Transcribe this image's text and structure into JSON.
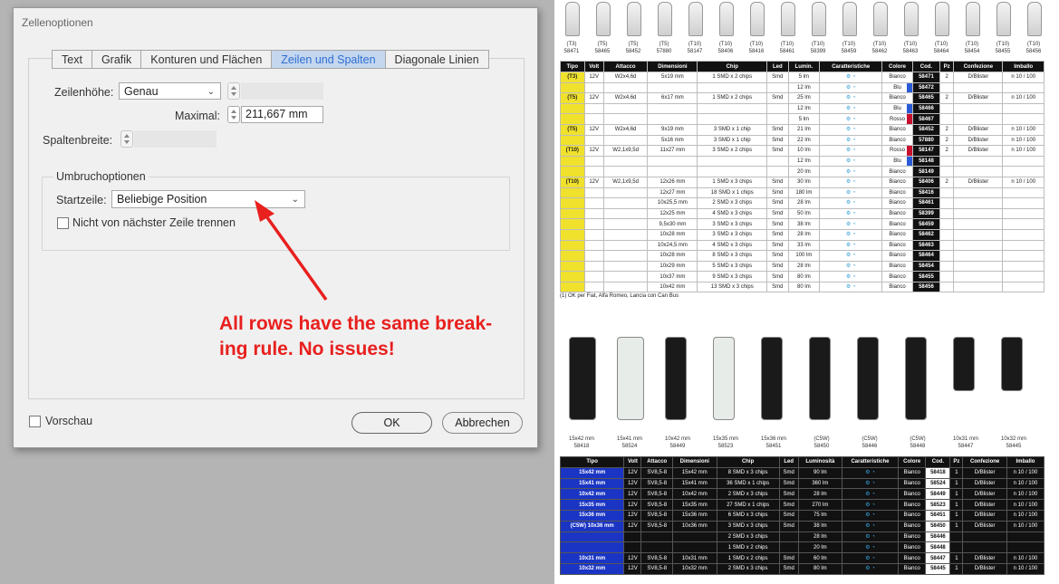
{
  "dialog": {
    "title": "Zellenoptionen",
    "tabs": [
      "Text",
      "Grafik",
      "Konturen und Flächen",
      "Zeilen und Spalten",
      "Diagonale Linien"
    ],
    "active_tab": "Zeilen und Spalten",
    "row_height_label": "Zeilenhöhe:",
    "row_height_value": "Genau",
    "maximal_label": "Maximal:",
    "maximal_value": "211,667 mm",
    "col_width_label": "Spaltenbreite:",
    "break_group_label": "Umbruchoptionen",
    "start_row_label": "Startzeile:",
    "start_row_value": "Beliebige Position",
    "keep_with_next_label": "Nicht von nächster Zeile trennen",
    "preview_label": "Vorschau",
    "ok_label": "OK",
    "cancel_label": "Abbrechen"
  },
  "annotation": {
    "line1": "All rows have the same break-",
    "line2": "ing rule. No issues!"
  },
  "colors": {
    "annotation_red": "#e8201e",
    "active_tab_blue": "#2f6ed2",
    "tipo_yellow": "#f0e22c",
    "tipo_blue": "#1a35c4"
  },
  "doc": {
    "top_captions": [
      [
        "(T3)",
        "58471"
      ],
      [
        "(T5)",
        "58465"
      ],
      [
        "(T5)",
        "58452"
      ],
      [
        "(T5)",
        "57880"
      ],
      [
        "(T10)",
        "58147"
      ],
      [
        "(T10)",
        "58406"
      ],
      [
        "(T10)",
        "58416"
      ],
      [
        "(T10)",
        "58461"
      ],
      [
        "(T10)",
        "58399"
      ],
      [
        "(T10)",
        "58459"
      ],
      [
        "(T10)",
        "58462"
      ],
      [
        "(T10)",
        "58463"
      ],
      [
        "(T10)",
        "58464"
      ],
      [
        "(T10)",
        "58454"
      ],
      [
        "(T10)",
        "58455"
      ],
      [
        "(T10)",
        "58456"
      ]
    ],
    "table1_headers": [
      "Tipo",
      "Volt",
      "Attacco",
      "Dimensioni",
      "Chip",
      "Led",
      "Lumin.",
      "Caratteristiche",
      "Colore",
      "Cod.",
      "Pz",
      "Confezione",
      "Imballo"
    ],
    "table1_rows": [
      [
        "(T3)",
        "12V",
        "W2x4,6d",
        "5x19 mm",
        "1 SMD x 2 chips",
        "Smd",
        "5 lm",
        "Bianco",
        "58471",
        "2",
        "D/Blister",
        "n 10 / 100"
      ],
      [
        "",
        "",
        "",
        "",
        "",
        "",
        "12 lm",
        "Blu",
        "58472",
        "",
        "",
        ""
      ],
      [
        "(T5)",
        "12V",
        "W2x4,6d",
        "6x17 mm",
        "1 SMD x 2 chips",
        "Smd",
        "25 lm",
        "Bianco",
        "58465",
        "2",
        "D/Blister",
        "n 10 / 100"
      ],
      [
        "",
        "",
        "",
        "",
        "",
        "",
        "12 lm",
        "Blu",
        "58466",
        "",
        "",
        ""
      ],
      [
        "",
        "",
        "",
        "",
        "",
        "",
        "5 lm",
        "Rosso",
        "58467",
        "",
        "",
        ""
      ],
      [
        "(T5)",
        "12V",
        "W2x4,6d",
        "9x19 mm",
        "3 SMD x 1 chip",
        "Smd",
        "21 lm",
        "Bianco",
        "58452",
        "2",
        "D/Blister",
        "n 10 / 100"
      ],
      [
        "",
        "",
        "",
        "5x16 mm",
        "3 SMD x 1 chip",
        "Smd",
        "22 lm",
        "Bianco",
        "57880",
        "2",
        "D/Blister",
        "n 10 / 100"
      ],
      [
        "(T10)",
        "12V",
        "W2,1x9,5d",
        "11x27 mm",
        "3 SMD x 2 chips",
        "Smd",
        "10 lm",
        "Rosso",
        "58147",
        "2",
        "D/Blister",
        "n 10 / 100"
      ],
      [
        "",
        "",
        "",
        "",
        "",
        "",
        "12 lm",
        "Blu",
        "58148",
        "",
        "",
        ""
      ],
      [
        "",
        "",
        "",
        "",
        "",
        "",
        "20 lm",
        "Bianco",
        "58149",
        "",
        "",
        ""
      ],
      [
        "(T10)",
        "12V",
        "W2,1x9,5d",
        "12x26 mm",
        "1 SMD x 3 chips",
        "Smd",
        "30 lm",
        "Bianco",
        "58406",
        "2",
        "D/Blister",
        "n 10 / 100"
      ],
      [
        "",
        "",
        "",
        "12x27 mm",
        "18 SMD x 1 chips",
        "Smd",
        "180 lm",
        "Bianco",
        "58416",
        "",
        "",
        ""
      ],
      [
        "",
        "",
        "",
        "10x25,5 mm",
        "2 SMD x 3 chips",
        "Smd",
        "28 lm",
        "Bianco",
        "58461",
        "",
        "",
        ""
      ],
      [
        "",
        "",
        "",
        "12x25 mm",
        "4 SMD x 3 chips",
        "Smd",
        "50 lm",
        "Bianco",
        "58399",
        "",
        "",
        ""
      ],
      [
        "",
        "",
        "",
        "9,5x30 mm",
        "3 SMD x 3 chips",
        "Smd",
        "38 lm",
        "Bianco",
        "58459",
        "",
        "",
        ""
      ],
      [
        "",
        "",
        "",
        "10x28 mm",
        "3 SMD x 3 chips",
        "Smd",
        "28 lm",
        "Bianco",
        "58462",
        "",
        "",
        ""
      ],
      [
        "",
        "",
        "",
        "10x24,5 mm",
        "4 SMD x 3 chips",
        "Smd",
        "33 lm",
        "Bianco",
        "58463",
        "",
        "",
        ""
      ],
      [
        "",
        "",
        "",
        "10x28 mm",
        "8 SMD x 3 chips",
        "Smd",
        "100 lm",
        "Bianco",
        "58464",
        "",
        "",
        ""
      ],
      [
        "",
        "",
        "",
        "10x29 mm",
        "5 SMD x 3 chips",
        "Smd",
        "28 lm",
        "Bianco",
        "58454",
        "",
        "",
        ""
      ],
      [
        "",
        "",
        "",
        "10x37 mm",
        "9 SMD x 3 chips",
        "Smd",
        "80 lm",
        "Bianco",
        "58455",
        "",
        "",
        ""
      ],
      [
        "",
        "",
        "",
        "10x42 mm",
        "13 SMD x 3 chips",
        "Smd",
        "80 lm",
        "Bianco",
        "58456",
        "",
        "",
        ""
      ]
    ],
    "footnote": "(1) OK per Fiat, Alfa Romeo, Lancia con Can Bus",
    "bottom_captions": [
      [
        "15x42 mm",
        "58418"
      ],
      [
        "15x41 mm",
        "58524"
      ],
      [
        "10x42 mm",
        "58449"
      ],
      [
        "15x35 mm",
        "58523"
      ],
      [
        "15x36 mm",
        "58451"
      ],
      [
        "(C5W)",
        "58450"
      ],
      [
        "(C5W)",
        "58446"
      ],
      [
        "(C5W)",
        "58448"
      ],
      [
        "10x31 mm",
        "58447"
      ],
      [
        "10x32 mm",
        "58445"
      ]
    ],
    "table2_headers": [
      "Tipo",
      "Volt",
      "Attacco",
      "Dimensioni",
      "Chip",
      "Led",
      "Luminosità",
      "Caratteristiche",
      "Colore",
      "Cod.",
      "Pz",
      "Confezione",
      "Imballo"
    ],
    "table2_rows": [
      [
        "15x42 mm",
        "12V",
        "SV8,5-8",
        "15x42 mm",
        "8 SMD x 3 chips",
        "Smd",
        "90 lm",
        "Bianco",
        "58418",
        "1",
        "D/Blister",
        "n 10 / 100"
      ],
      [
        "15x41 mm",
        "12V",
        "SV8,5-8",
        "15x41 mm",
        "36 SMD x 1 chips",
        "Smd",
        "360 lm",
        "Bianco",
        "58524",
        "1",
        "D/Blister",
        "n 10 / 100"
      ],
      [
        "10x42 mm",
        "12V",
        "SV8,5-8",
        "10x42 mm",
        "2 SMD x 3 chips",
        "Smd",
        "28 lm",
        "Bianco",
        "58449",
        "1",
        "D/Blister",
        "n 10 / 100"
      ],
      [
        "15x35 mm",
        "12V",
        "SV8,5-8",
        "15x35 mm",
        "27 SMD x 1 chips",
        "Smd",
        "270 lm",
        "Bianco",
        "58523",
        "1",
        "D/Blister",
        "n 10 / 100"
      ],
      [
        "15x36 mm",
        "12V",
        "SV8,5-8",
        "15x36 mm",
        "6 SMD x 3 chips",
        "Smd",
        "75 lm",
        "Bianco",
        "58451",
        "1",
        "D/Blister",
        "n 10 / 100"
      ],
      [
        "(C5W) 10x36 mm",
        "12V",
        "SV8,5-8",
        "10x36 mm",
        "3 SMD x 3 chips",
        "Smd",
        "38 lm",
        "Bianco",
        "58450",
        "1",
        "D/Blister",
        "n 10 / 100"
      ],
      [
        "",
        "",
        "",
        "",
        "2 SMD x 3 chips",
        "",
        "28 lm",
        "Bianco",
        "58446",
        "",
        "",
        ""
      ],
      [
        "",
        "",
        "",
        "",
        "1 SMD x 2 chips",
        "",
        "20 lm",
        "Bianco",
        "58448",
        "",
        "",
        ""
      ],
      [
        "10x31 mm",
        "12V",
        "SV8,5-8",
        "10x31 mm",
        "1 SMD x 2 chips",
        "Smd",
        "60 lm",
        "Bianco",
        "58447",
        "1",
        "D/Blister",
        "n 10 / 100"
      ],
      [
        "10x32 mm",
        "12V",
        "SV8,5-8",
        "10x32 mm",
        "2 SMD x 3 chips",
        "Smd",
        "80 lm",
        "Bianco",
        "58445",
        "1",
        "D/Blister",
        "n 10 / 100"
      ]
    ]
  }
}
